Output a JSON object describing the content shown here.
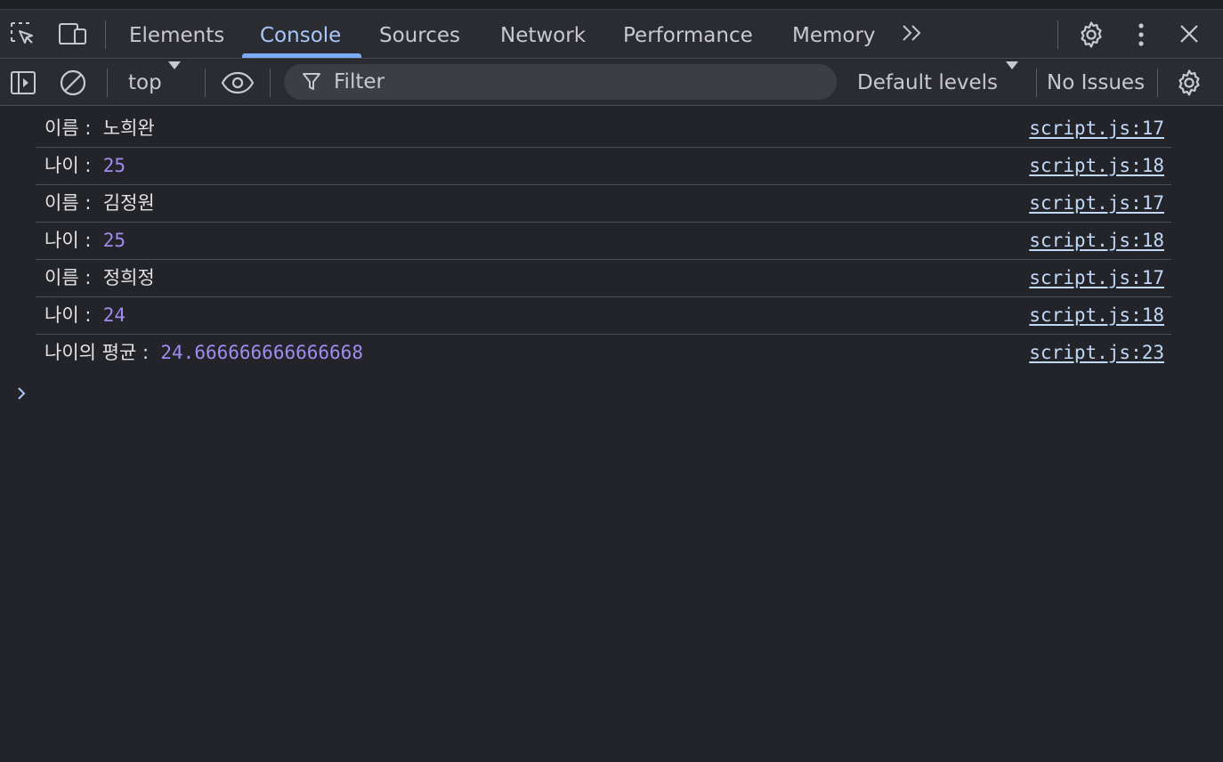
{
  "tabs": [
    {
      "label": "Elements"
    },
    {
      "label": "Console",
      "active": true
    },
    {
      "label": "Sources"
    },
    {
      "label": "Network"
    },
    {
      "label": "Performance"
    },
    {
      "label": "Memory"
    }
  ],
  "toolbar": {
    "context": "top",
    "filter_placeholder": "Filter",
    "levels": "Default levels",
    "issues": "No Issues"
  },
  "console": {
    "rows": [
      {
        "label": "이름 :  ",
        "value": "노희완",
        "value_type": "string",
        "source": "script.js:17"
      },
      {
        "label": "나이 :  ",
        "value": "25",
        "value_type": "number",
        "source": "script.js:18"
      },
      {
        "label": "이름 :  ",
        "value": "김정원",
        "value_type": "string",
        "source": "script.js:17"
      },
      {
        "label": "나이 :  ",
        "value": "25",
        "value_type": "number",
        "source": "script.js:18"
      },
      {
        "label": "이름 :  ",
        "value": "정희정",
        "value_type": "string",
        "source": "script.js:17"
      },
      {
        "label": "나이 :  ",
        "value": "24",
        "value_type": "number",
        "source": "script.js:18"
      },
      {
        "label": "나이의 평균 :  ",
        "value": "24.666666666666668",
        "value_type": "number",
        "source": "script.js:23"
      }
    ]
  },
  "colors": {
    "background": "#232429",
    "active_tab": "#a8c7fa",
    "number_value": "#9f8cf0",
    "source_link": "#c2d8f7"
  }
}
